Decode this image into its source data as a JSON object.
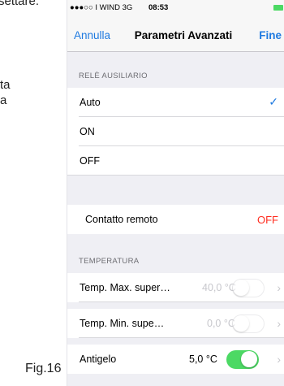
{
  "document": {
    "text_line_1": "settare.",
    "text_line_2": "ta",
    "text_line_3": "a",
    "figure_label": "Fig.16"
  },
  "status_bar": {
    "carrier": "●●●○○ I WIND  3G",
    "time": "08:53",
    "battery_color": "#4cd964"
  },
  "nav": {
    "cancel": "Annulla",
    "title": "Parametri Avanzati",
    "done": "Fine",
    "accent_color": "#1f7ae0"
  },
  "aux_relay": {
    "header": "RELÈ AUSILIARIO",
    "options": [
      {
        "label": "Auto",
        "selected": true
      },
      {
        "label": "ON",
        "selected": false
      },
      {
        "label": "OFF",
        "selected": false
      }
    ],
    "check_icon": "✓"
  },
  "remote_contact": {
    "label": "Contatto remoto",
    "value": "OFF",
    "value_color": "#ff2d20"
  },
  "temperature": {
    "header": "TEMPERATURA",
    "rows": [
      {
        "label": "Temp. Max. super…",
        "value": "40,0 °C",
        "enabled": false
      },
      {
        "label": "Temp. Min. supe…",
        "value": "0,0 °C",
        "enabled": false
      },
      {
        "label": "Antigelo",
        "value": "5,0 °C",
        "enabled": true
      }
    ],
    "chevron_icon": "›"
  }
}
